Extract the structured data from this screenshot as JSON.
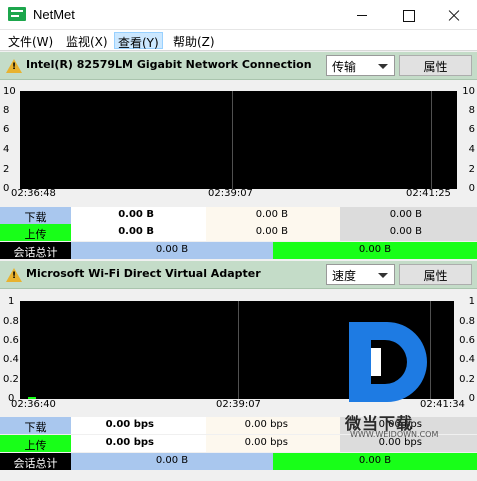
{
  "window": {
    "title": "NetMet"
  },
  "menu": {
    "items": [
      "文件(W)",
      "监视(X)",
      "查看(Y)",
      "帮助(Z)"
    ],
    "active_index": 2
  },
  "panels": [
    {
      "adapter": "Intel(R) 82579LM Gigabit Network Connection",
      "mode": "传输",
      "properties_label": "属性",
      "y_ticks": [
        "10",
        "8",
        "6",
        "4",
        "2",
        "0"
      ],
      "x_ticks": [
        "02:36:48",
        "02:39:07",
        "02:41:25"
      ],
      "rows": [
        {
          "label": "下载",
          "v1": "0.00 B",
          "v2": "0.00 B",
          "v3": "0.00 B"
        },
        {
          "label": "上传",
          "v1": "0.00 B",
          "v2": "0.00 B",
          "v3": "0.00 B"
        }
      ],
      "total": {
        "label": "会话总计",
        "a": "0.00 B",
        "b": "0.00 B"
      }
    },
    {
      "adapter": "Microsoft Wi-Fi Direct Virtual Adapter",
      "mode": "速度",
      "properties_label": "属性",
      "y_ticks": [
        "1",
        "0.8",
        "0.6",
        "0.4",
        "0.2",
        "0"
      ],
      "x_ticks": [
        "02:36:40",
        "02:39:07",
        "02:41:34"
      ],
      "rows": [
        {
          "label": "下载",
          "v1": "0.00 bps",
          "v2": "0.00 bps",
          "v3": "0.00 bps"
        },
        {
          "label": "上传",
          "v1": "0.00 bps",
          "v2": "0.00 bps",
          "v3": "0.00 bps"
        }
      ],
      "total": {
        "label": "会话总计",
        "a": "0.00 B",
        "b": "0.00 B"
      }
    }
  ],
  "watermark": {
    "text": "微当下载",
    "url": "WWW.WEIDOWN.COM",
    "color": "#1e7be3"
  },
  "colors": {
    "header": "#c4dcc8",
    "download": "#a9c7ee",
    "upload": "#18ff18",
    "plot": "#000000"
  }
}
